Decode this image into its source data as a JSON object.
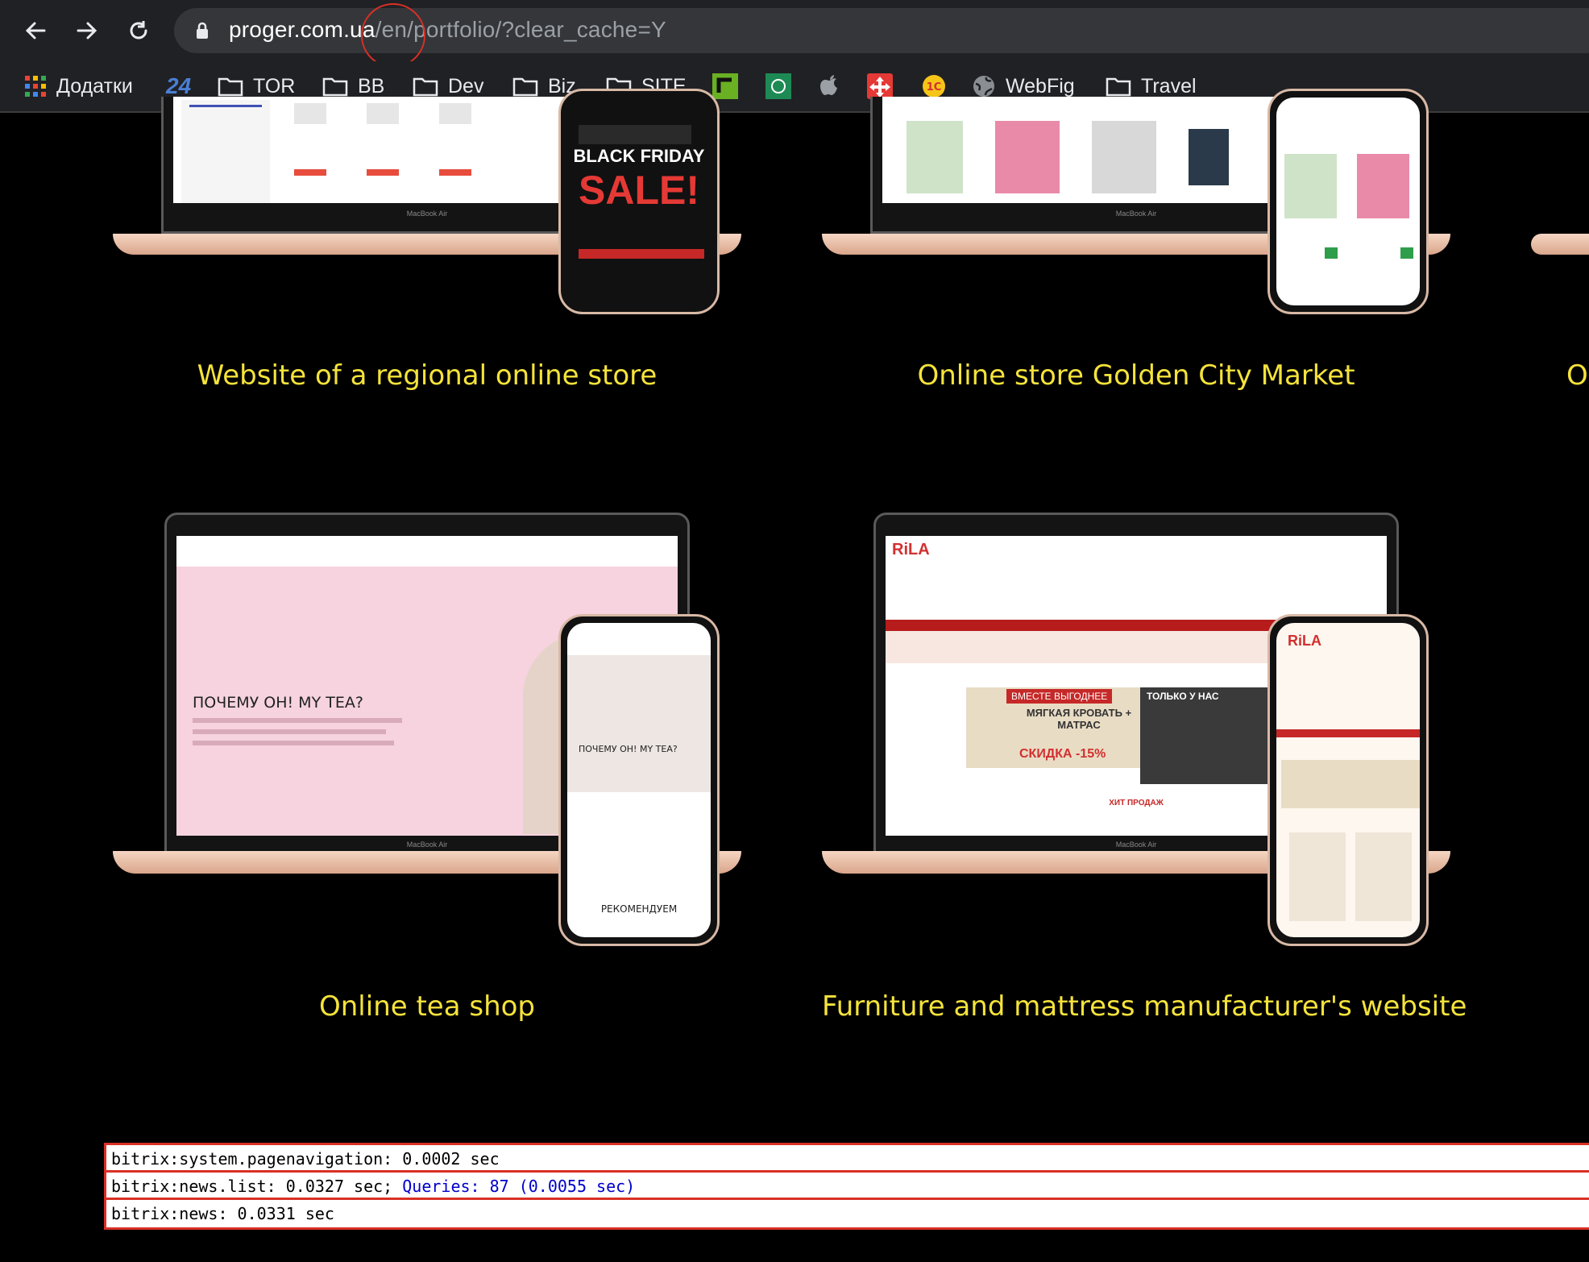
{
  "browser": {
    "url_host": "proger.com.ua",
    "url_path": "/en/portfolio/?clear_cache=Y"
  },
  "bookmarks": [
    {
      "label": "Додатки",
      "icon": "apps-grid-icon"
    },
    {
      "label": "",
      "icon": "24-icon"
    },
    {
      "label": "TOR",
      "icon": "folder-icon"
    },
    {
      "label": "BB",
      "icon": "folder-icon"
    },
    {
      "label": "Dev",
      "icon": "folder-icon"
    },
    {
      "label": "Biz",
      "icon": "folder-icon"
    },
    {
      "label": "SITE",
      "icon": "folder-icon"
    },
    {
      "label": "",
      "icon": "green-site-icon"
    },
    {
      "label": "",
      "icon": "bank-icon"
    },
    {
      "label": "",
      "icon": "apple-icon"
    },
    {
      "label": "",
      "icon": "red-logo-icon"
    },
    {
      "label": "",
      "icon": "1c-icon"
    },
    {
      "label": "WebFig",
      "icon": "globe-icon"
    },
    {
      "label": "Travel",
      "icon": "folder-icon"
    }
  ],
  "portfolio": {
    "items": [
      {
        "title": "Website of a regional online store"
      },
      {
        "title": "Online store Golden City Market"
      },
      {
        "title": "O"
      },
      {
        "title": "Online tea shop"
      },
      {
        "title": "Furniture and mattress manufacturer's website"
      }
    ],
    "mock": {
      "laptop_label": "MacBook Air",
      "sale_title": "BLACK FRIDAY",
      "sale_big": "SALE!",
      "tea_heading": "ПОЧЕМУ ОН! MY TEA?",
      "tea_recommend": "РЕКОМЕНДУЕМ",
      "rila_brand": "RiLA",
      "rila_banner_a": "ВМЕСТЕ ВЫГОДНЕЕ",
      "rila_banner_b": "МЯГКАЯ КРОВАТЬ + МАТРАС",
      "rila_banner_c": "СКИДКА -15%",
      "rila_banner_d": "ТОЛЬКО У НАС",
      "rila_hits": "ХИТ ПРОДАЖ"
    }
  },
  "debug": {
    "row1": "bitrix:system.pagenavigation: 0.0002 sec",
    "row2_prefix": "bitrix:news.list: 0.0327 sec; ",
    "row2_link": "Queries: 87 (0.0055 sec)",
    "row3": "bitrix:news: 0.0331 sec"
  },
  "colors": {
    "title_yellow": "#f5e33a",
    "debug_border": "#d93025",
    "chrome_bg": "#202124"
  }
}
